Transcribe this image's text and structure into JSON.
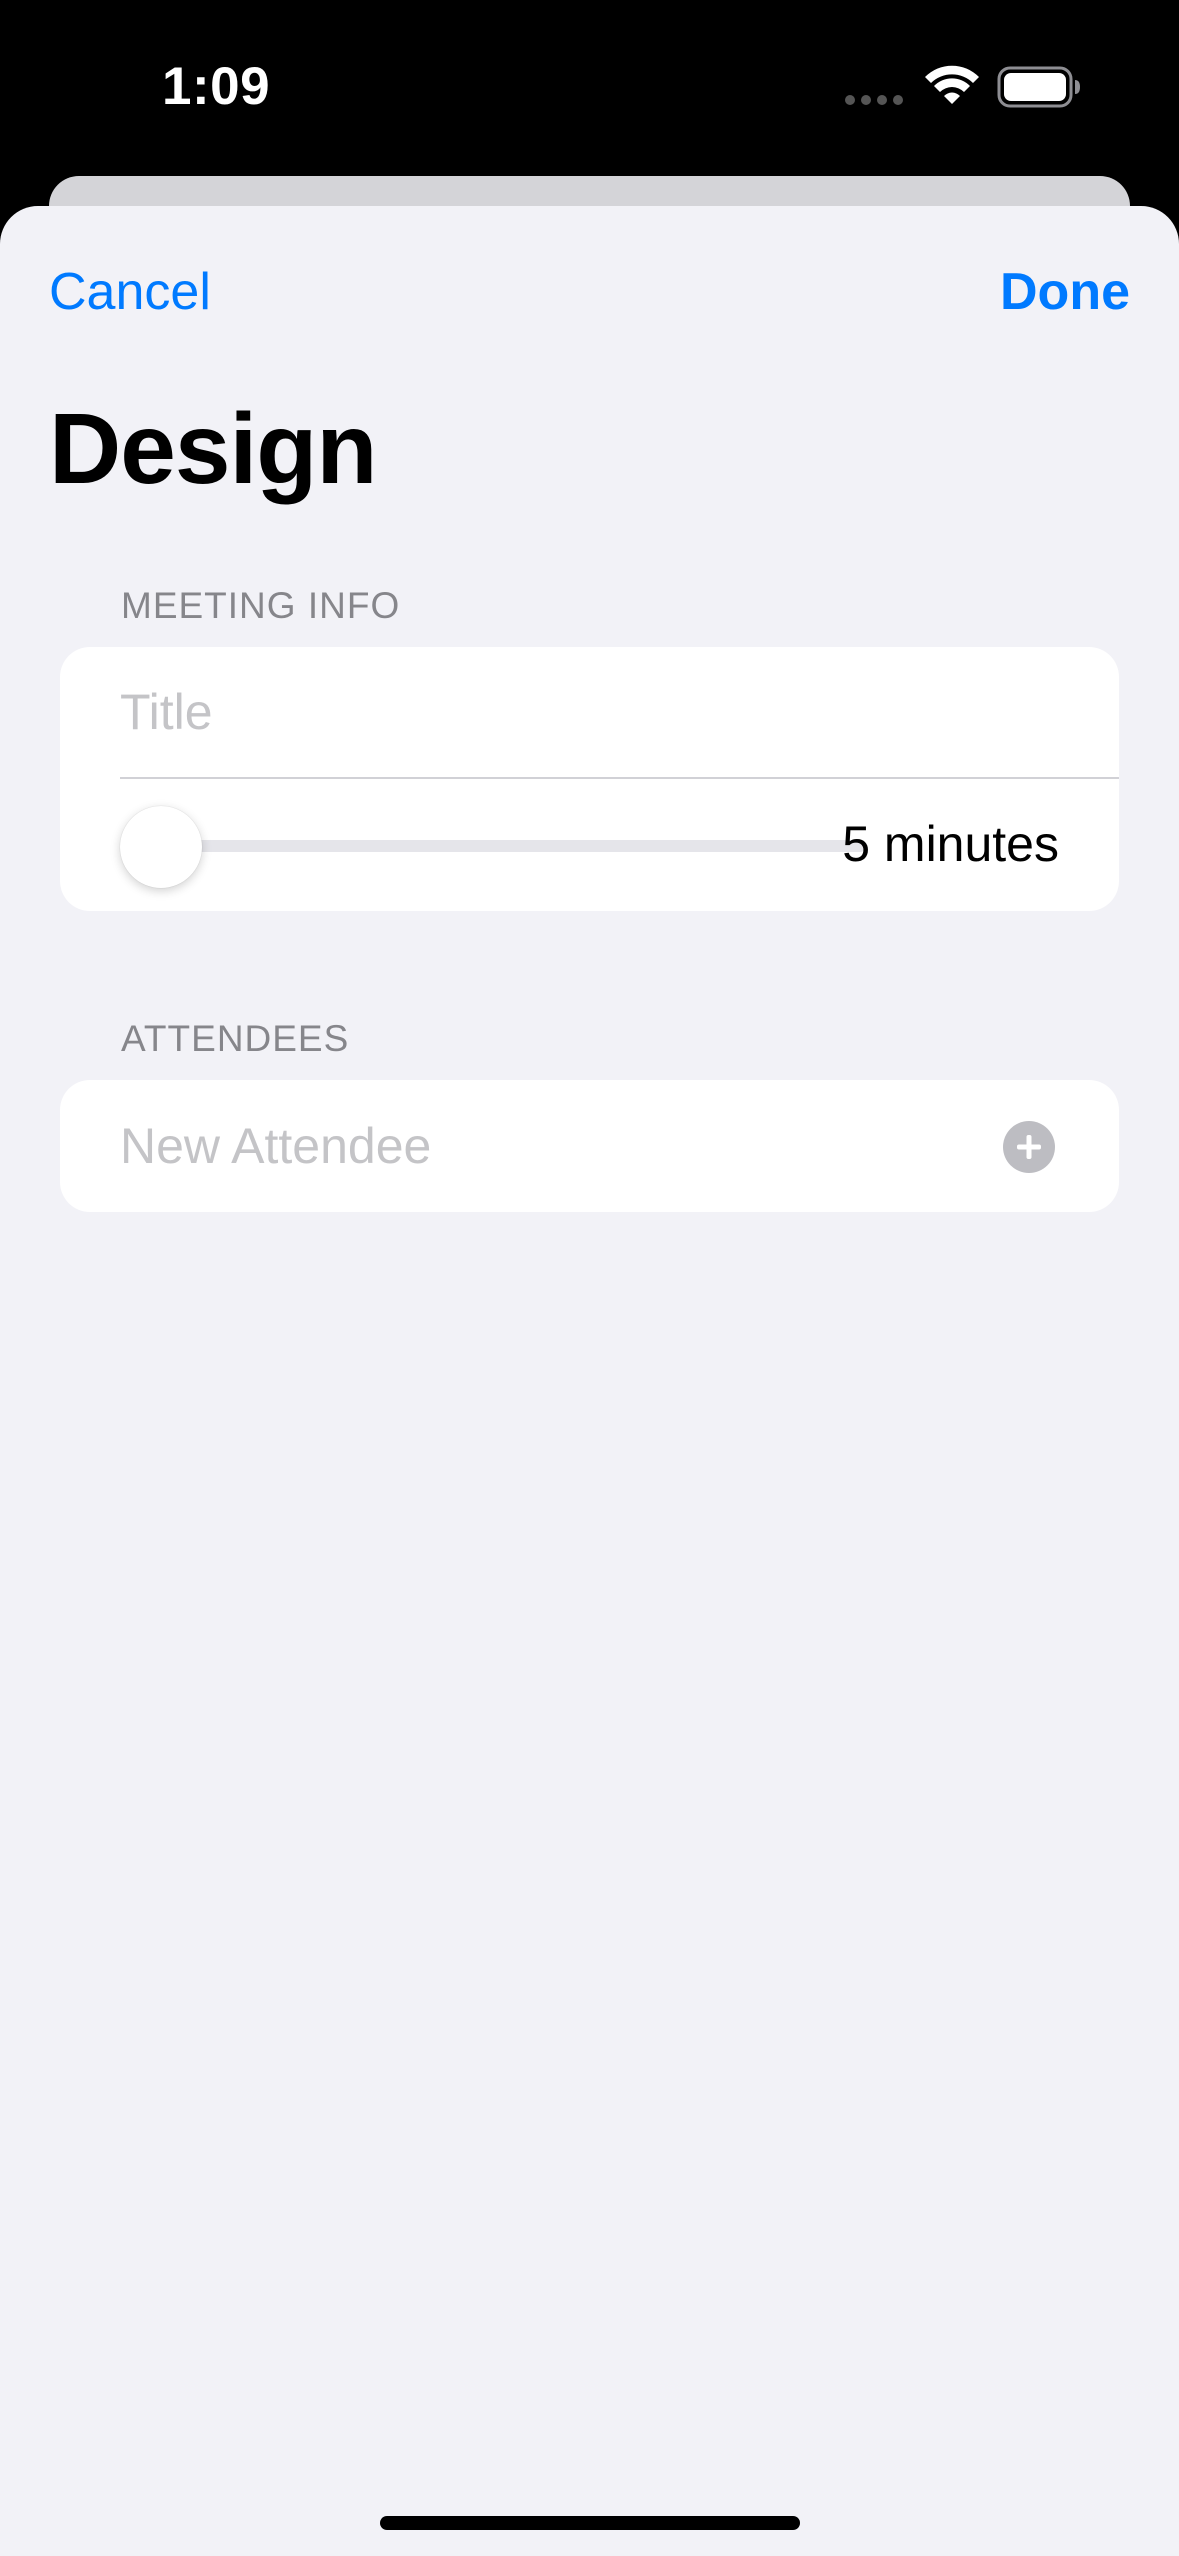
{
  "status_bar": {
    "time": "1:09"
  },
  "nav": {
    "cancel_label": "Cancel",
    "done_label": "Done"
  },
  "page": {
    "title": "Design"
  },
  "meeting_info": {
    "header": "MEETING INFO",
    "title_placeholder": "Title",
    "title_value": "",
    "duration_label": "5 minutes",
    "duration_slider_fraction": 0
  },
  "attendees": {
    "header": "ATTENDEES",
    "new_attendee_placeholder": "New Attendee",
    "add_icon": "plus-circle-icon"
  },
  "colors": {
    "accent": "#007aff",
    "background": "#f2f2f7",
    "secondary_text": "#86868b",
    "placeholder": "#c4c4c7"
  }
}
